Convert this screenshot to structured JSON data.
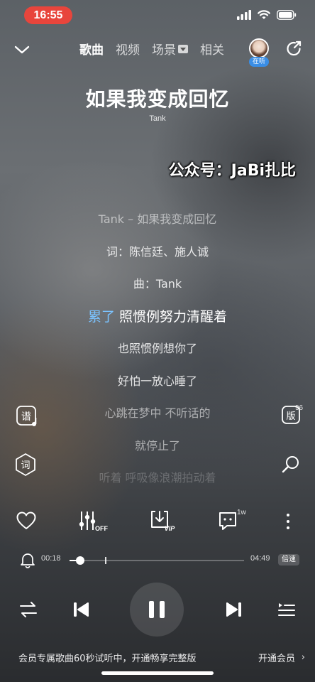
{
  "status_bar": {
    "time": "16:55",
    "icons": [
      "signal-icon",
      "wifi-icon",
      "battery-icon"
    ]
  },
  "header": {
    "tabs": [
      {
        "label": "歌曲",
        "active": true
      },
      {
        "label": "视频",
        "active": false
      },
      {
        "label": "场景",
        "active": false,
        "has_dropdown": true
      },
      {
        "label": "相关",
        "active": false
      }
    ],
    "avatar_badge": "在听"
  },
  "song": {
    "title": "如果我变成回忆",
    "artist": "Tank"
  },
  "watermark": "公众号：JaBi扎比",
  "lyrics": {
    "lines": [
      {
        "text": "Tank – 如果我变成回忆",
        "state": "dim"
      },
      {
        "text": "词：陈信廷、施人诚",
        "state": "normal"
      },
      {
        "text": "曲：Tank",
        "state": "normal"
      },
      {
        "text_sung": "累了",
        "text_rest": " 照惯例努力清醒着",
        "state": "current"
      },
      {
        "text": "也照惯例想你了",
        "state": "normal"
      },
      {
        "text": "好怕一放心睡了",
        "state": "normal"
      },
      {
        "text": "心跳在梦中 不听话的",
        "state": "dim"
      },
      {
        "text": "就停止了",
        "state": "dim"
      },
      {
        "text": "听着 呼吸像浪潮拍动着",
        "state": "faint"
      }
    ]
  },
  "side_buttons": {
    "score_label": "谱",
    "version_label": "版",
    "version_count": "96",
    "lyrics_label": "词"
  },
  "actions": {
    "sound_effect_label": "OFF",
    "download_label": "VIP",
    "comment_count": "1w"
  },
  "progress": {
    "elapsed": "00:18",
    "duration": "04:49",
    "played_fraction": 0.062,
    "trial_end_fraction": 0.207,
    "speed_label": "倍速"
  },
  "vip_banner": {
    "text": "会员专属歌曲60秒试听中，开通畅享完整版",
    "link": "开通会员",
    "chevron": "›"
  },
  "colors": {
    "status_time_bg": "#e8453c",
    "lyric_highlight": "#7bc3ff",
    "listening_badge": "#3a8ee6"
  }
}
